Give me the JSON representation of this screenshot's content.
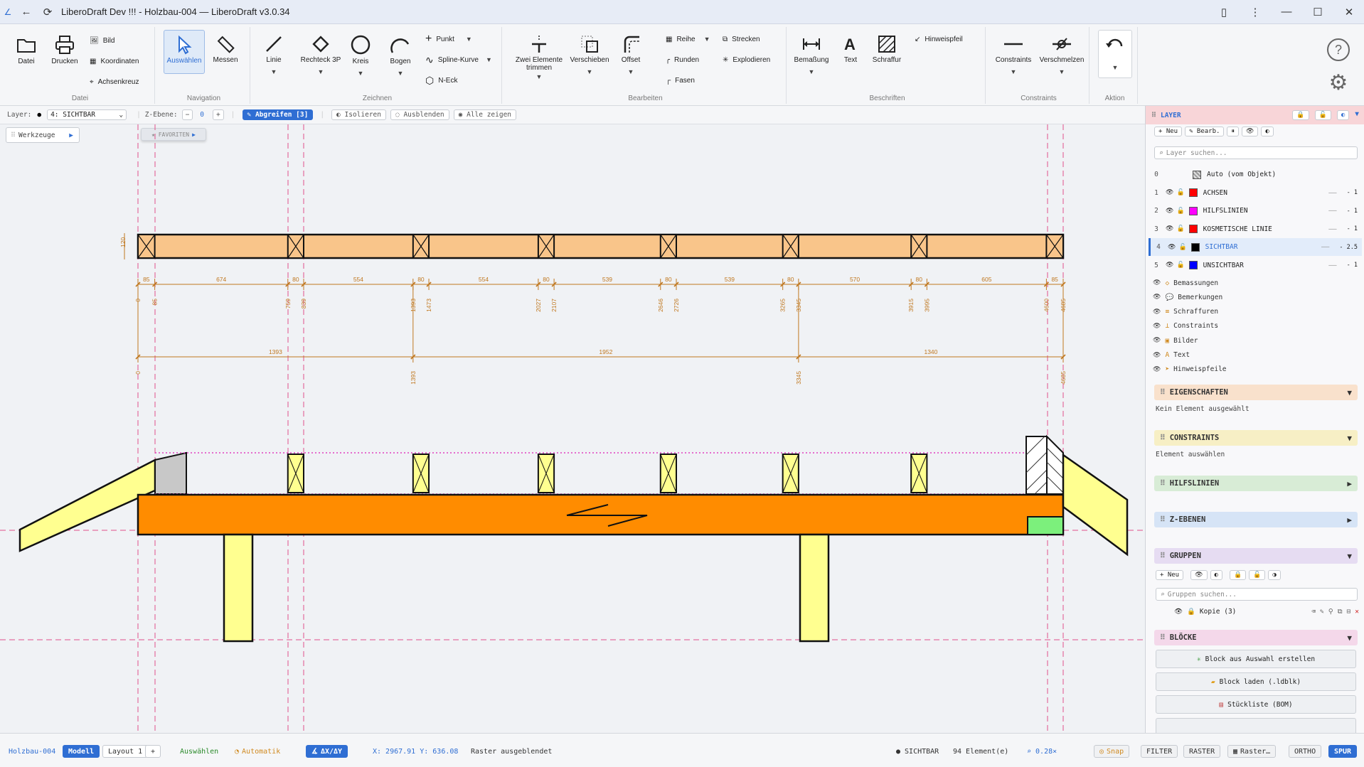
{
  "window": {
    "title": "LiberoDraft Dev !!! - Holzbau-004 — LiberoDraft v3.0.34"
  },
  "ribbon": {
    "datei": {
      "datei": "Datei",
      "drucken": "Drucken",
      "bild": "Bild",
      "koordinaten": "Koordinaten",
      "achsenkreuz": "Achsenkreuz",
      "group": "Datei"
    },
    "navigation": {
      "auswaehlen": "Auswählen",
      "messen": "Messen",
      "group": "Navigation"
    },
    "zeichnen": {
      "linie": "Linie",
      "rechteck": "Rechteck 3P",
      "kreis": "Kreis",
      "bogen": "Bogen",
      "punkt": "Punkt",
      "spline": "Spline-Kurve",
      "neck": "N-Eck",
      "group": "Zeichnen"
    },
    "bearbeiten": {
      "trimmen": "Zwei Elemente trimmen",
      "verschieben": "Verschieben",
      "offset": "Offset",
      "reihe": "Reihe",
      "runden": "Runden",
      "fasen": "Fasen",
      "strecken": "Strecken",
      "explodieren": "Explodieren",
      "group": "Bearbeiten"
    },
    "beschriften": {
      "bemassung": "Bemaßung",
      "text": "Text",
      "schraffur": "Schraffur",
      "hinweispfeil": "Hinweispfeil",
      "group": "Beschriften"
    },
    "constraints": {
      "constraints": "Constraints",
      "verschmelzen": "Verschmelzen",
      "group": "Constraints"
    },
    "aktion": {
      "group": "Aktion"
    }
  },
  "options": {
    "layer_label": "Layer:",
    "layer_value": "4: SICHTBAR",
    "z_label": "Z-Ebene:",
    "z_value": "0",
    "abgreifen": "Abgreifen [3]",
    "isolieren": "Isolieren",
    "ausblenden": "Ausblenden",
    "alle_zeigen": "Alle zeigen"
  },
  "canvas": {
    "werkzeuge": "Werkzeuge",
    "favoriten": "★ FAVORITEN",
    "dims_row1": [
      "85",
      "674",
      "80",
      "554",
      "80",
      "554",
      "80",
      "539",
      "80",
      "539",
      "80",
      "570",
      "80",
      "605",
      "85"
    ],
    "dims_row1_marks": [
      "0",
      "85",
      "759",
      "839",
      "1393",
      "1473",
      "2027",
      "2107",
      "2646",
      "2726",
      "3265",
      "3345",
      "3915",
      "3995",
      "4600",
      "4685"
    ],
    "dims_row2": [
      "1393",
      "1952",
      "1340"
    ],
    "dims_row2_marks": [
      "0",
      "1393",
      "3345",
      "4685"
    ],
    "height_dim": "120"
  },
  "layers": {
    "title": "LAYER",
    "btn_neu": "+ Neu",
    "btn_bearb": "✎ Bearb.",
    "search_placeholder": "Layer suchen...",
    "items": [
      {
        "num": "0",
        "name": "Auto (vom Objekt)",
        "color": "#aaaaaa",
        "width": ""
      },
      {
        "num": "1",
        "name": "ACHSEN",
        "color": "#ff0000",
        "width": "1"
      },
      {
        "num": "2",
        "name": "HILFSLINIEN",
        "color": "#ff00ff",
        "width": "1"
      },
      {
        "num": "3",
        "name": "KOSMETISCHE LINIE",
        "color": "#ff0000",
        "width": "1"
      },
      {
        "num": "4",
        "name": "SICHTBAR",
        "color": "#000000",
        "width": "2.5"
      },
      {
        "num": "5",
        "name": "UNSICHTBAR",
        "color": "#0000ff",
        "width": "1"
      }
    ],
    "categories": [
      "Bemassungen",
      "Bemerkungen",
      "Schraffuren",
      "Constraints",
      "Bilder",
      "Text",
      "Hinweispfeile"
    ]
  },
  "eigenschaften": {
    "title": "EIGENSCHAFTEN",
    "body": "Kein Element ausgewählt"
  },
  "constraints_panel": {
    "title": "CONSTRAINTS",
    "body": "Element auswählen"
  },
  "hilfslinien": {
    "title": "HILFSLINIEN"
  },
  "zebenen": {
    "title": "Z-EBENEN"
  },
  "gruppen": {
    "title": "GRUPPEN",
    "btn_neu": "+ Neu",
    "search_placeholder": "Gruppen suchen...",
    "item": "Kopie (3)"
  },
  "bloecke": {
    "title": "BLÖCKE",
    "create": "Block aus Auswahl erstellen",
    "load": "Block laden (.ldblk)",
    "bom": "Stückliste (BOM)"
  },
  "status": {
    "file": "Holzbau-004",
    "tab_modell": "Modell",
    "tab_layout": "Layout 1",
    "tab_add": "+",
    "mode": "Auswählen",
    "automatik": "Automatik",
    "delta": "ΔX/ΔY",
    "coords": "X: 2967.91  Y: 636.08",
    "raster_msg": "Raster ausgeblendet",
    "layer": "SICHTBAR",
    "count": "94 Element(e)",
    "zoom": "0.28×",
    "snap": "Snap",
    "filter": "FILTER",
    "raster": "RASTER",
    "raster2": "Raster…",
    "ortho": "ORTHO",
    "spur": "SPUR"
  }
}
